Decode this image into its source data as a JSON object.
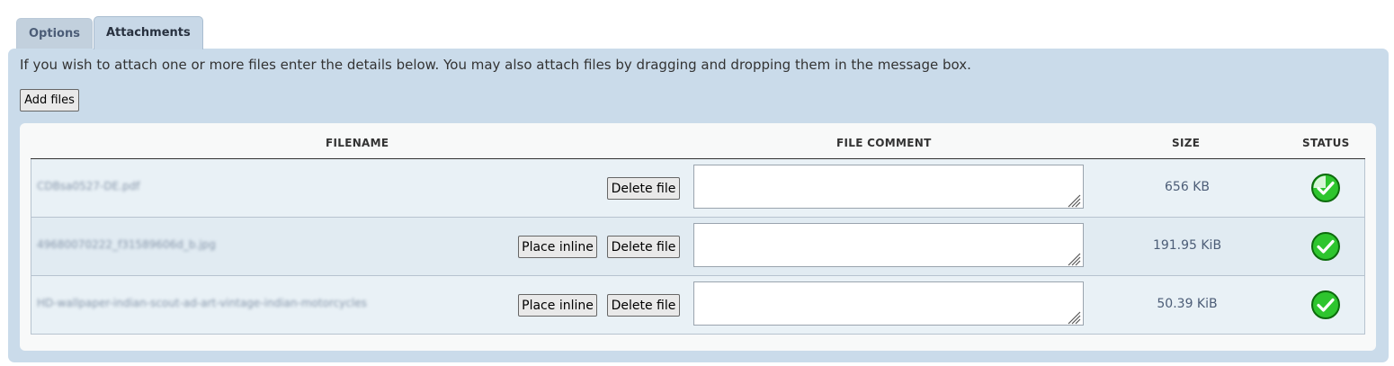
{
  "tabs": [
    {
      "label": "Options",
      "active": false
    },
    {
      "label": "Attachments",
      "active": true
    }
  ],
  "intro_text": "If you wish to attach one or more files enter the details below. You may also attach files by dragging and dropping them in the message box.",
  "add_files_label": "Add files",
  "table": {
    "headers": {
      "filename": "FILENAME",
      "comment": "FILE COMMENT",
      "size": "SIZE",
      "status": "STATUS"
    },
    "rows": [
      {
        "filename": "CDBsa0527-DE.pdf",
        "place_inline": "",
        "delete": "Delete file",
        "comment": "",
        "size": "656 KB",
        "status": "complete-partial"
      },
      {
        "filename": "49680070222_f31589606d_b.jpg",
        "place_inline": "Place inline",
        "delete": "Delete file",
        "comment": "",
        "size": "191.95 KiB",
        "status": "complete"
      },
      {
        "filename": "HD-wallpaper-indian-scout-ad-art-vintage-indian-motorcycles",
        "place_inline": "Place inline",
        "delete": "Delete file",
        "comment": "",
        "size": "50.39 KiB",
        "status": "complete"
      }
    ]
  },
  "icons": {
    "status": "check-circle-icon",
    "resize": "resize-grip-icon"
  },
  "colors": {
    "panel": "#cadbea",
    "status_green": "#2ec52e",
    "muted_text": "#4c5d77"
  }
}
